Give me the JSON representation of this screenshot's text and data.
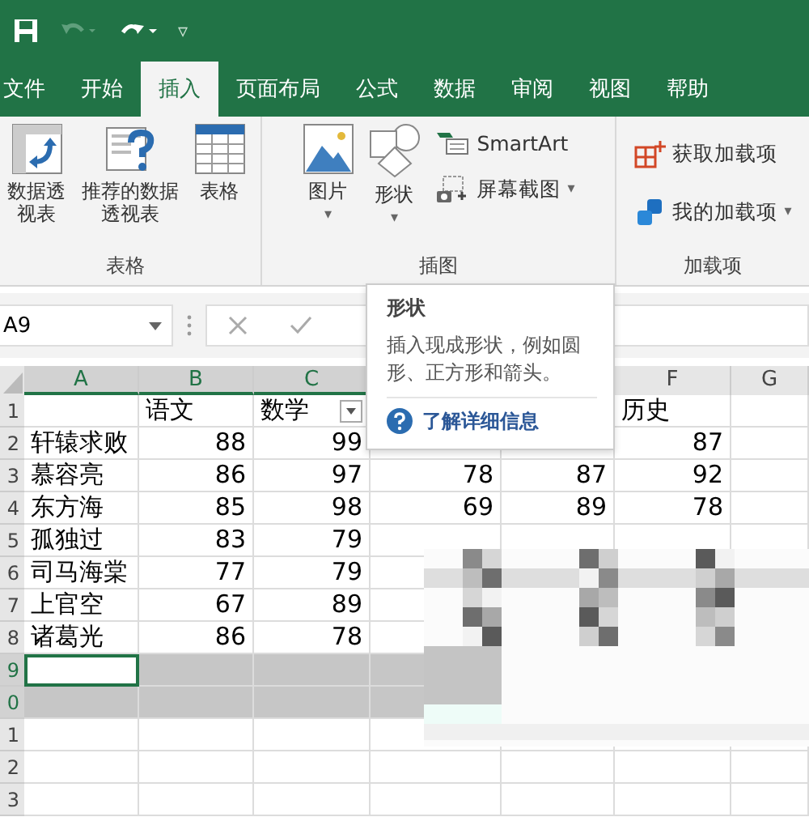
{
  "quick_access": {
    "dropdown": "▿"
  },
  "tabs": [
    {
      "label": "文件",
      "selected": false
    },
    {
      "label": "开始",
      "selected": false
    },
    {
      "label": "插入",
      "selected": true
    },
    {
      "label": "页面布局",
      "selected": false
    },
    {
      "label": "公式",
      "selected": false
    },
    {
      "label": "数据",
      "selected": false
    },
    {
      "label": "审阅",
      "selected": false
    },
    {
      "label": "视图",
      "selected": false
    },
    {
      "label": "帮助",
      "selected": false
    }
  ],
  "ribbon_groups": [
    {
      "label": "表格",
      "items": [
        {
          "kind": "pivot",
          "label": "数据透视表"
        },
        {
          "kind": "recommended",
          "label": "推荐的数据透视表"
        },
        {
          "kind": "table",
          "label": "表格"
        }
      ]
    },
    {
      "label": "插图",
      "items": [
        {
          "kind": "picture",
          "label": "图片",
          "dropdown": "▾"
        },
        {
          "kind": "shapes",
          "label": "形状",
          "dropdown": "▾"
        },
        {
          "kind": "stack",
          "children": [
            {
              "kind": "smartart",
              "label": "SmartArt"
            },
            {
              "kind": "screenshot",
              "label": "屏幕截图",
              "dropdown": "▾"
            }
          ]
        }
      ]
    },
    {
      "label": "加载项",
      "items": [
        {
          "kind": "stack",
          "children": [
            {
              "kind": "getaddins",
              "label": "获取加载项"
            },
            {
              "kind": "myaddins",
              "label": "我的加载项",
              "dropdown": "▾"
            }
          ]
        }
      ]
    }
  ],
  "name_box": "A9",
  "tooltip": {
    "title": "形状",
    "description": "插入现成形状，例如圆形、正方形和箭头。",
    "link": "了解详细信息"
  },
  "sheet": {
    "columns": [
      {
        "label": "A",
        "selected": true
      },
      {
        "label": "B",
        "selected": true
      },
      {
        "label": "C",
        "selected": true
      },
      null,
      null,
      {
        "label": "F",
        "selected": false
      },
      {
        "label": "G",
        "selected": false
      }
    ],
    "rows": [
      {
        "number": "1",
        "selected": false,
        "active": false,
        "cells": [
          "",
          "语文",
          "数学",
          "",
          "",
          "历史",
          ""
        ],
        "filters": [
          false,
          false,
          true,
          false,
          false,
          false,
          false
        ]
      },
      {
        "number": "2",
        "selected": false,
        "active": false,
        "cells": [
          "轩辕求败",
          "88",
          "99",
          "",
          "",
          "87",
          ""
        ]
      },
      {
        "number": "3",
        "selected": false,
        "active": false,
        "cells": [
          "慕容亮",
          "86",
          "97",
          "78",
          "87",
          "92",
          ""
        ]
      },
      {
        "number": "4",
        "selected": false,
        "active": false,
        "cells": [
          "东方海",
          "85",
          "98",
          "69",
          "89",
          "78",
          ""
        ]
      },
      {
        "number": "5",
        "selected": false,
        "active": false,
        "cells": [
          "孤独过",
          "83",
          "79",
          "",
          "",
          "",
          ""
        ]
      },
      {
        "number": "6",
        "selected": false,
        "active": false,
        "cells": [
          "司马海棠",
          "77",
          "79",
          "",
          "",
          "",
          ""
        ]
      },
      {
        "number": "7",
        "selected": false,
        "active": false,
        "cells": [
          "上官空",
          "67",
          "89",
          "",
          "",
          "",
          ""
        ]
      },
      {
        "number": "8",
        "selected": false,
        "active": false,
        "cells": [
          "诸葛光",
          "86",
          "78",
          "",
          "",
          "",
          ""
        ]
      },
      {
        "number": "9",
        "selected": true,
        "active": true,
        "cells": [
          "",
          "",
          "",
          "",
          "",
          "",
          ""
        ]
      },
      {
        "number": "0",
        "selected": true,
        "active": false,
        "cells": [
          "",
          "",
          "",
          "",
          "",
          "",
          ""
        ]
      },
      {
        "number": "1",
        "selected": false,
        "active": false,
        "cells": [
          "",
          "",
          "",
          "",
          "",
          "",
          ""
        ]
      },
      {
        "number": "2",
        "selected": false,
        "active": false,
        "cells": [
          "",
          "",
          "",
          "",
          "",
          "",
          ""
        ]
      },
      {
        "number": "3",
        "selected": false,
        "active": false,
        "cells": [
          "",
          "",
          "",
          "",
          "",
          "",
          ""
        ]
      }
    ]
  }
}
